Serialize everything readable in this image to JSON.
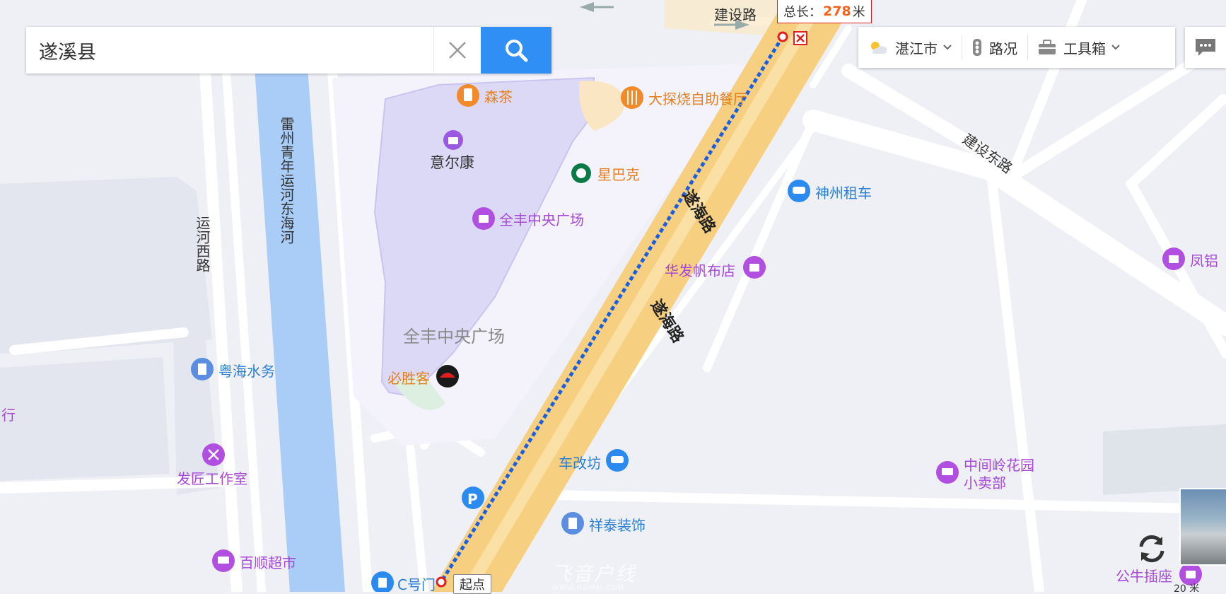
{
  "search": {
    "value": "遂溪县"
  },
  "toolbar": {
    "city": "湛江市",
    "traffic": "路况",
    "toolbox": "工具箱"
  },
  "route": {
    "distance_prefix": "总长：",
    "distance_value": "278",
    "distance_unit": "米",
    "start_label": "起点"
  },
  "roads": {
    "jianshe": "建设路",
    "jianshe_east": "建设东路",
    "suihai_1": "遂海路",
    "suihai_2": "遂海路",
    "yunhe_west": "运河西路",
    "canal": "雷州青年运河东海河"
  },
  "pois": {
    "sencha": "森茶",
    "datanshao": "大探烧自助餐厅",
    "yierkang": "意尔康",
    "starbucks": "星巴克",
    "quanfeng_plaza_poi": "全丰中央广场",
    "quanfeng_plaza_area": "全丰中央广场",
    "pizzahut": "必胜客",
    "shenzhou": "神州租车",
    "huafa": "华发帆布店",
    "fenglv": "凤铝",
    "yuehai": "粤海水务",
    "fajiang": "发匠工作室",
    "chegaifang": "车改坊",
    "zhongjianling": "中间岭花园",
    "zhongjianling2": "小卖部",
    "xiangtai": "祥泰装饰",
    "baishun": "百顺超市",
    "gate_c": "C号门",
    "gongniu": "公牛插座",
    "edge_text": "行"
  },
  "watermark": {
    "main": "飞音户线",
    "sub": "WWW.GDMM.COM"
  },
  "colors": {
    "route": "#1a5fe0",
    "main_road": "#f7cf80",
    "canal": "#a9cdf7",
    "mall": "#ddd9f7",
    "pink_poi": "#b150e0",
    "orange_poi": "#f08a2a"
  },
  "scale": {
    "text": "20 米"
  }
}
